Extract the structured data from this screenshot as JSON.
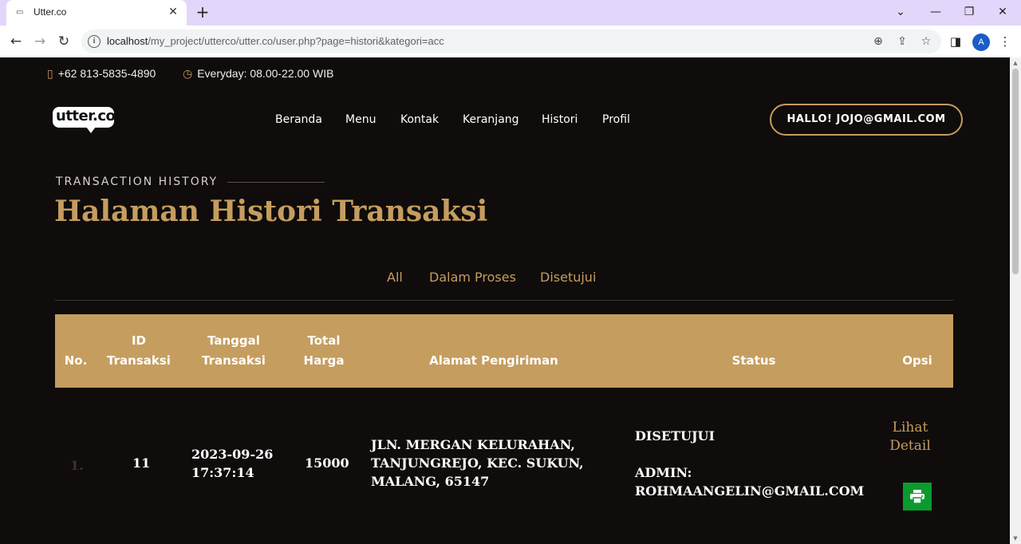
{
  "browser": {
    "tab_title": "Utter.co",
    "url_host": "localhost",
    "url_path": "/my_project/utterco/utter.co/user.php?page=histori&kategori=acc",
    "avatar_letter": "A"
  },
  "topbar": {
    "phone": "+62 813-5835-4890",
    "hours": "Everyday: 08.00-22.00 WIB"
  },
  "brand": {
    "logo_text": "utter.co",
    "accent_color": "#c59d5f"
  },
  "nav": {
    "items": [
      "Beranda",
      "Menu",
      "Kontak",
      "Keranjang",
      "Histori",
      "Profil"
    ],
    "user_button": "HALLO! JOJO@GMAIL.COM"
  },
  "section": {
    "eyebrow": "TRANSACTION HISTORY",
    "title": "Halaman Histori Transaksi"
  },
  "filters": [
    "All",
    "Dalam Proses",
    "Disetujui"
  ],
  "table": {
    "headers": {
      "no": "No.",
      "id_line1": "ID",
      "id_line2": "Transaksi",
      "date_line1": "Tanggal",
      "date_line2": "Transaksi",
      "total_line1": "Total",
      "total_line2": "Harga",
      "address": "Alamat Pengiriman",
      "status": "Status",
      "options": "Opsi"
    },
    "rows": [
      {
        "no": "1.",
        "id": "11",
        "date": "2023-09-26",
        "time": "17:37:14",
        "total": "15000",
        "address_line1": "JLN. MERGAN KELURAHAN,",
        "address_line2": "TANJUNGREJO, KEC. SUKUN,",
        "address_line3": "MALANG, 65147",
        "status": "DISETUJUI",
        "admin_label": "ADMIN:",
        "admin_email": "ROHMAANGELIN@GMAIL.COM",
        "detail_line1": "Lihat",
        "detail_line2": "Detail",
        "print_icon": "printer-icon"
      }
    ]
  }
}
